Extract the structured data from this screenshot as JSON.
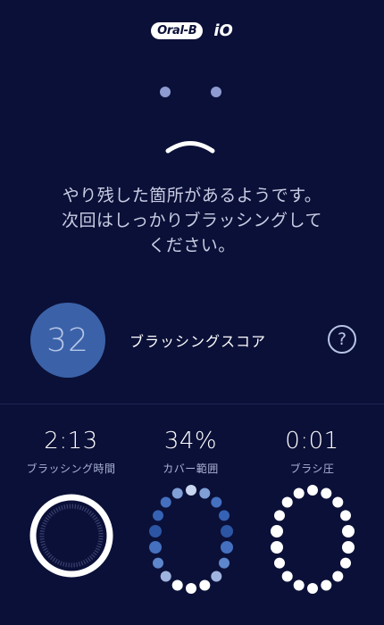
{
  "header": {
    "brand": "Oral-B",
    "product": "iO"
  },
  "message": {
    "lines": [
      "やり残した箇所があるようです。",
      "次回はしっかりブラッシングして",
      "ください。"
    ]
  },
  "score": {
    "value": "32",
    "label": "ブラッシングスコア",
    "help_icon": "?"
  },
  "stats": [
    {
      "value": "2:13",
      "label": "ブラッシング時間"
    },
    {
      "value": "34%",
      "label": "カバー範囲"
    },
    {
      "value": "0:01",
      "label": "ブラシ圧"
    }
  ],
  "colors": {
    "background": "#0b1038",
    "score_circle": "#3b62a8",
    "coverage_full": "#ffffff",
    "coverage_partial": "#2c55a3"
  }
}
